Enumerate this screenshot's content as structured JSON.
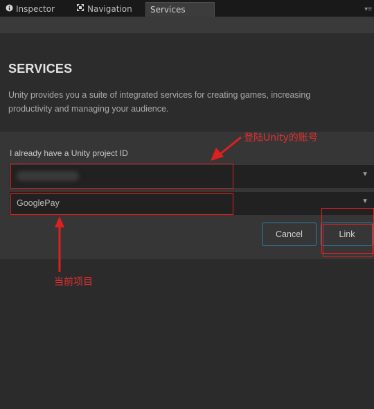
{
  "tabs": [
    {
      "label": "Inspector",
      "icon": "info-icon"
    },
    {
      "label": "Navigation",
      "icon": "navigation-icon"
    },
    {
      "label": "Services",
      "icon": ""
    }
  ],
  "services": {
    "title": "SERVICES",
    "description": "Unity provides you a suite of integrated services for creating games, increasing productivity and managing your audience.",
    "project_id_label": "I already have a Unity project ID",
    "account_dropdown_value": "",
    "project_dropdown_value": "GooglePay",
    "cancel_label": "Cancel",
    "link_label": "Link"
  },
  "annotations": {
    "account_note": "登陆Unity的账号",
    "project_note": "当前项目"
  },
  "colors": {
    "accent_border": "#2d7fa5",
    "annotation_red": "#e02020"
  }
}
